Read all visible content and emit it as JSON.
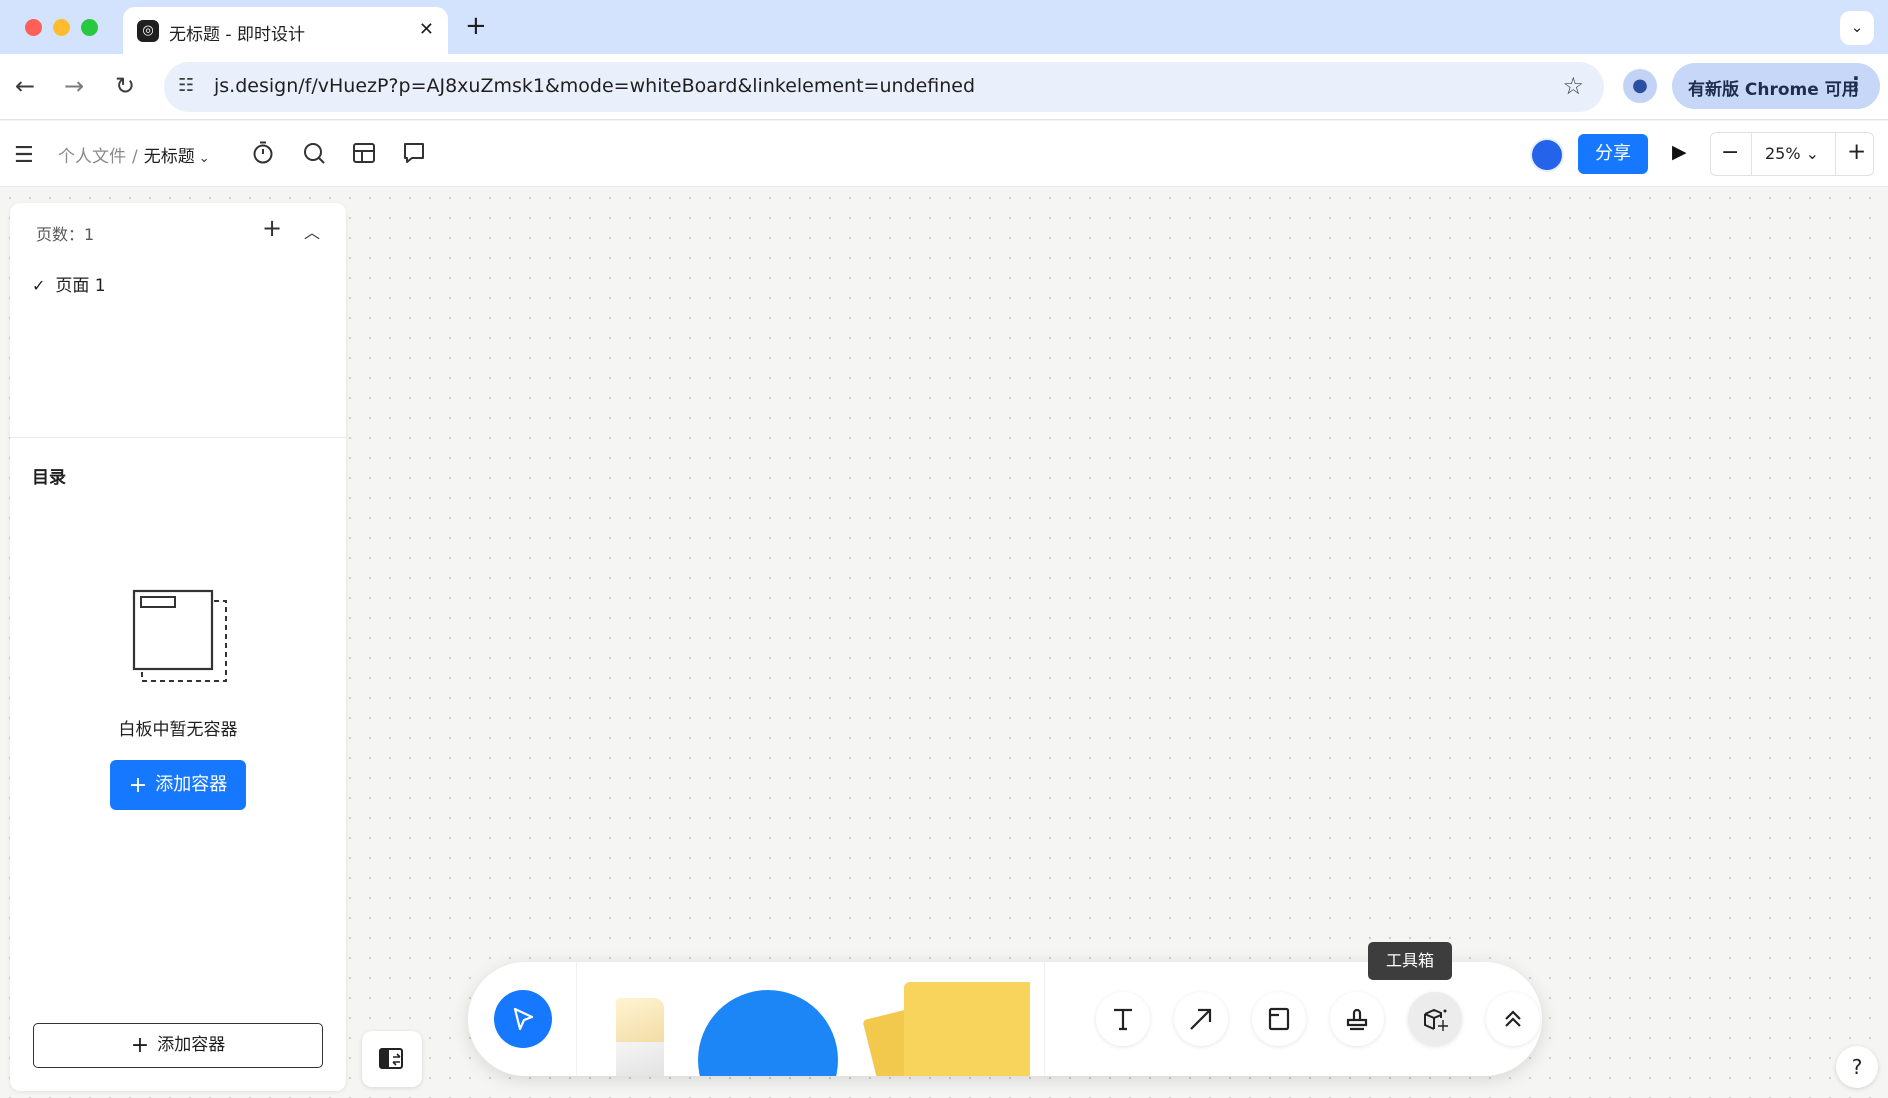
{
  "browser": {
    "tab_title": "无标题 - 即时设计",
    "tab_close": "✕",
    "new_tab": "+",
    "url": "js.design/f/vHuezP?p=AJ8xuZmsk1&mode=whiteBoard&linkelement=undefined",
    "update_chip": "有新版 Chrome 可用",
    "icons": {
      "back": "arrow-left-icon",
      "forward": "arrow-right-icon",
      "reload": "reload-icon",
      "site_info": "tune-icon",
      "bookmark": "star-icon",
      "profile": "person-icon",
      "menu": "kebab-menu-icon",
      "tab_search": "chevron-down-icon"
    }
  },
  "app": {
    "breadcrumb_parent": "个人文件",
    "breadcrumb_sep": "/",
    "breadcrumb_current": "无标题",
    "share_label": "分享",
    "zoom_value": "25%",
    "zoom_minus": "−",
    "zoom_plus": "+",
    "accent_color": "#1677ff",
    "header_icons": [
      "menu-icon",
      "timer-icon",
      "search-icon",
      "layout-icon",
      "comment-icon",
      "play-icon"
    ]
  },
  "sidebar": {
    "pages_label": "页数：1",
    "pages": [
      {
        "label": "页面 1",
        "selected": true
      }
    ],
    "toc_title": "目录",
    "empty_text": "白板中暂无容器",
    "add_container_label": "添加容器",
    "add_container_bottom_label": "添加容器"
  },
  "toolbar": {
    "tooltip": "工具箱",
    "tools": [
      "select-tool",
      "eraser-tool",
      "shape-tool",
      "sticky-note-tool",
      "text-tool",
      "arrow-tool",
      "frame-tool",
      "stamp-tool",
      "toolbox-tool",
      "more-tools"
    ]
  },
  "help_label": "?"
}
